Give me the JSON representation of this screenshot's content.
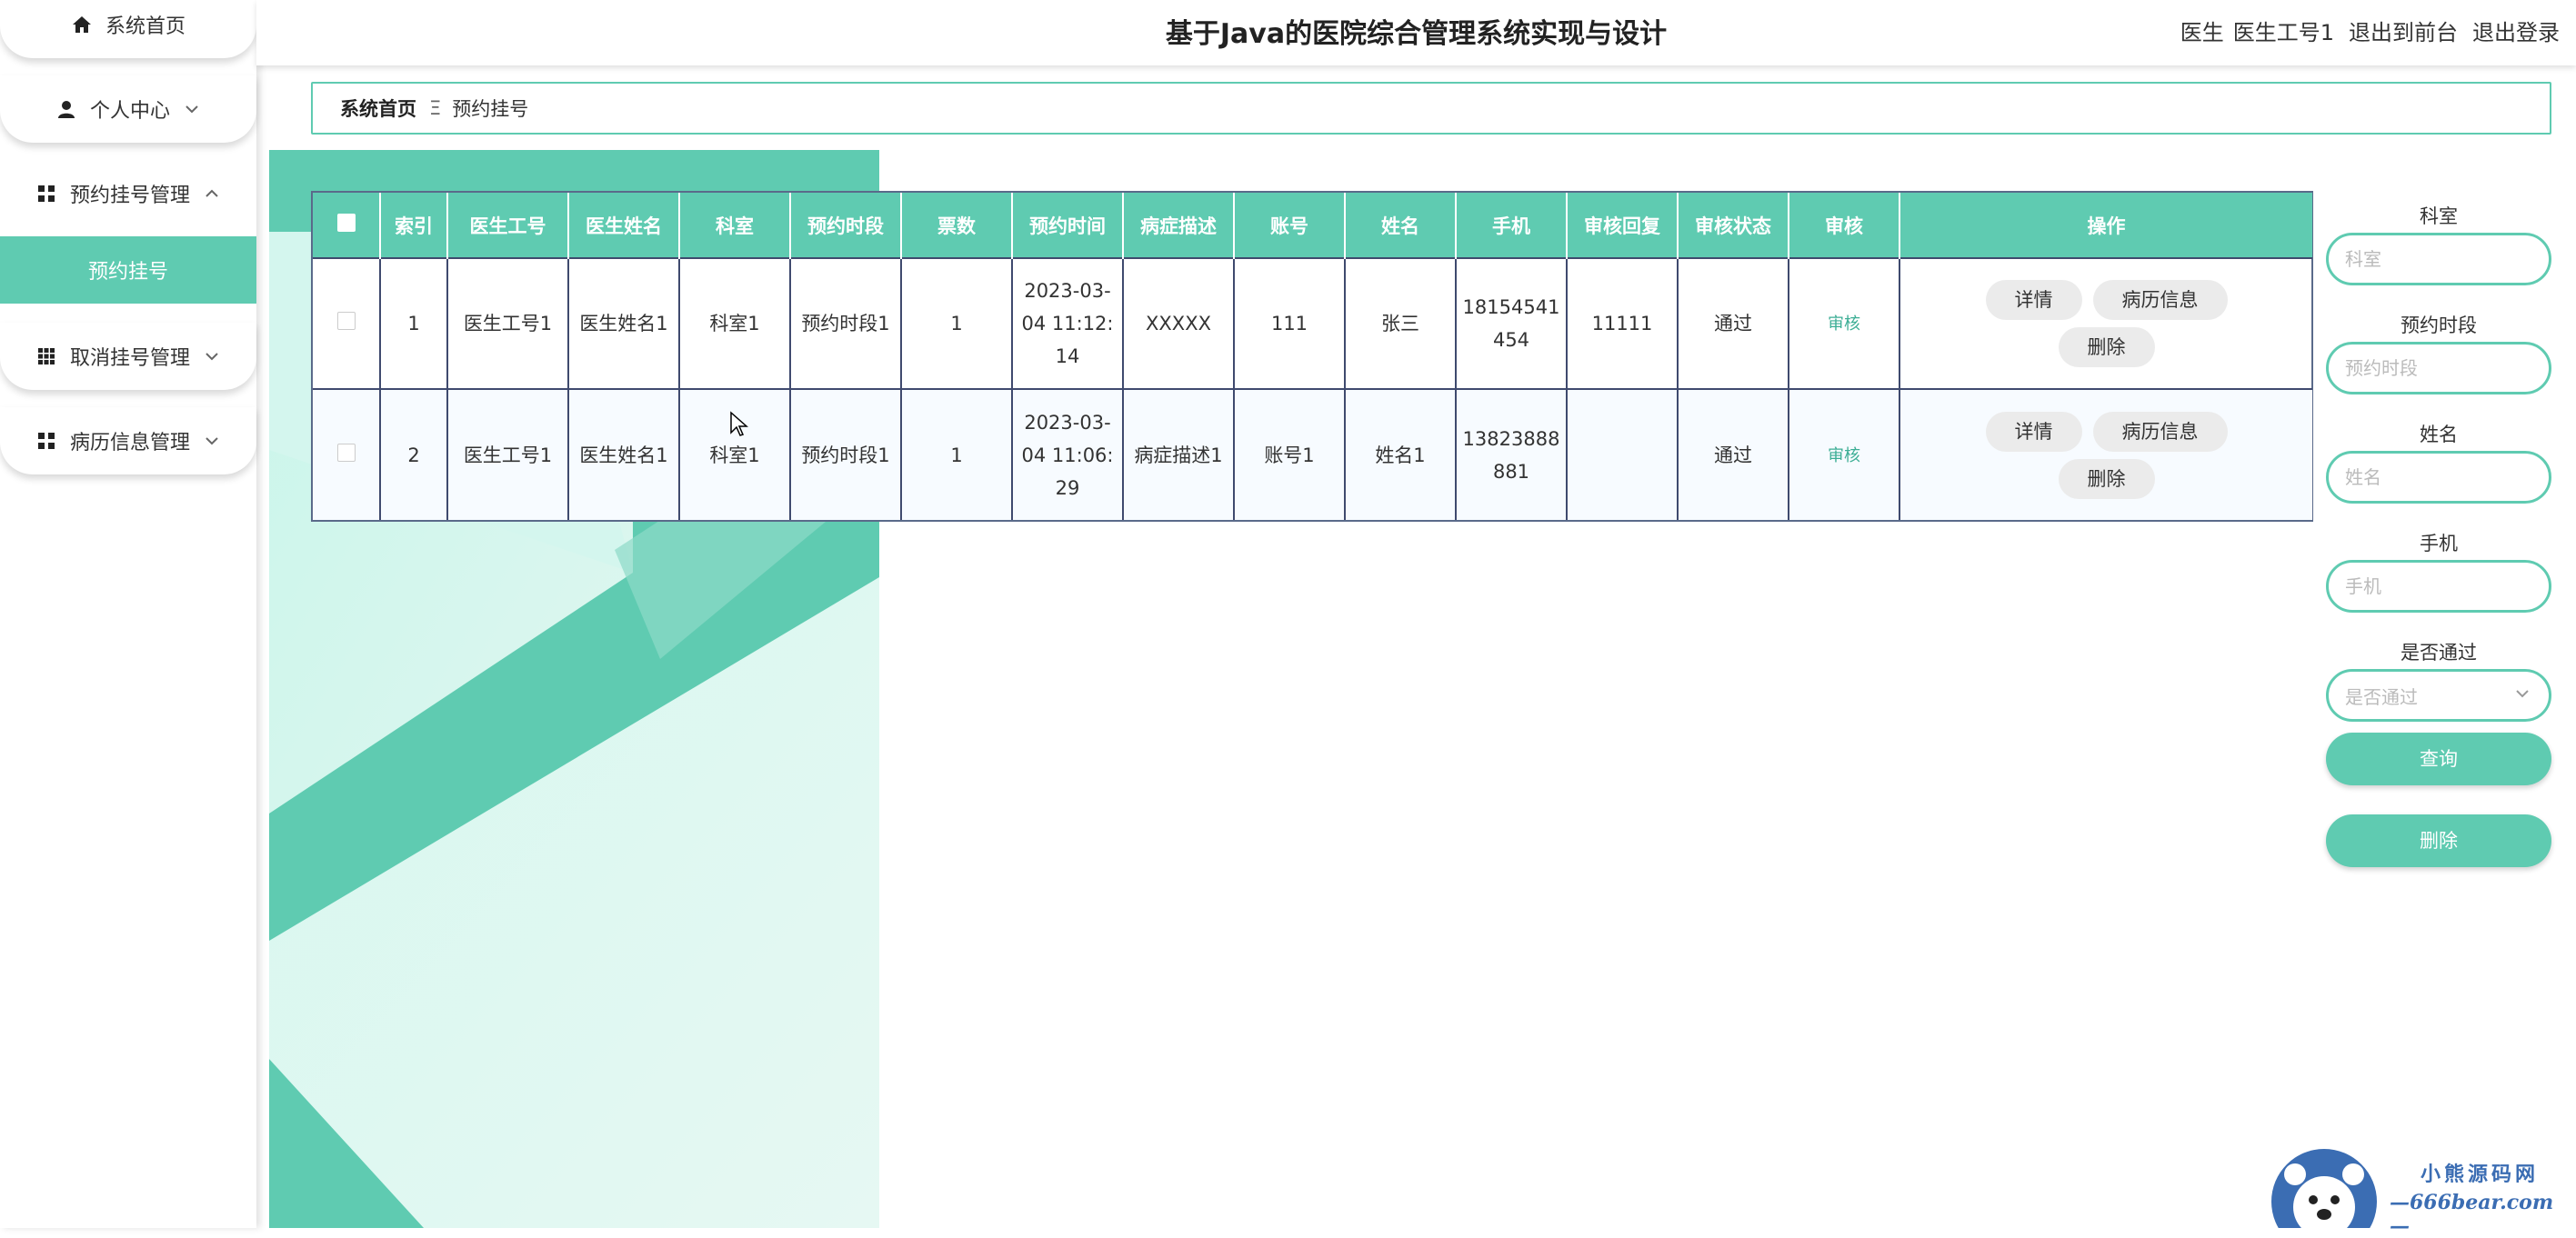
{
  "app": {
    "title": "基于Java的医院综合管理系统实现与设计",
    "user_role": "医生",
    "user_name": "医生工号1",
    "front_link": "退出到前台",
    "logout_link": "退出登录"
  },
  "sidebar": {
    "items": [
      {
        "label": "系统首页",
        "icon": "home-icon"
      },
      {
        "label": "个人中心",
        "icon": "user-icon"
      },
      {
        "label": "预约挂号管理",
        "icon": "grid-icon"
      },
      {
        "label": "取消挂号管理",
        "icon": "grid-icon"
      },
      {
        "label": "病历信息管理",
        "icon": "grid-icon"
      }
    ],
    "active_sub": "预约挂号"
  },
  "breadcrumb": {
    "home": "系统首页",
    "separator": "Ξ",
    "current": "预约挂号"
  },
  "table": {
    "headers": [
      "索引",
      "医生工号",
      "医生姓名",
      "科室",
      "预约时段",
      "票数",
      "预约时间",
      "病症描述",
      "账号",
      "姓名",
      "手机",
      "审核回复",
      "审核状态",
      "审核",
      "操作"
    ],
    "rows": [
      {
        "index": "1",
        "doctor_no": "医生工号1",
        "doctor_name": "医生姓名1",
        "dept": "科室1",
        "slot": "预约时段1",
        "tickets": "1",
        "time": "2023-03-04 11:12:14",
        "symptom": "XXXXX",
        "account": "111",
        "name": "张三",
        "phone": "18154541454",
        "reply": "11111",
        "status": "通过",
        "audit": "审核"
      },
      {
        "index": "2",
        "doctor_no": "医生工号1",
        "doctor_name": "医生姓名1",
        "dept": "科室1",
        "slot": "预约时段1",
        "tickets": "1",
        "time": "2023-03-04 11:06:29",
        "symptom": "病症描述1",
        "account": "账号1",
        "name": "姓名1",
        "phone": "13823888881",
        "reply": "",
        "status": "通过",
        "audit": "审核"
      }
    ],
    "actions": {
      "detail": "详情",
      "record": "病历信息",
      "delete": "删除"
    }
  },
  "filters": {
    "dept": {
      "label": "科室",
      "placeholder": "科室"
    },
    "slot": {
      "label": "预约时段",
      "placeholder": "预约时段"
    },
    "name": {
      "label": "姓名",
      "placeholder": "姓名"
    },
    "phone": {
      "label": "手机",
      "placeholder": "手机"
    },
    "passed": {
      "label": "是否通过",
      "placeholder": "是否通过"
    },
    "search_button": "查询",
    "delete_button": "删除"
  },
  "watermark": {
    "line1": "小熊源码网",
    "line2": "—666bear.com—"
  },
  "colors": {
    "accent": "#5fcbb1",
    "accent_dark": "#3cae95",
    "table_border": "#3f4a6e"
  }
}
